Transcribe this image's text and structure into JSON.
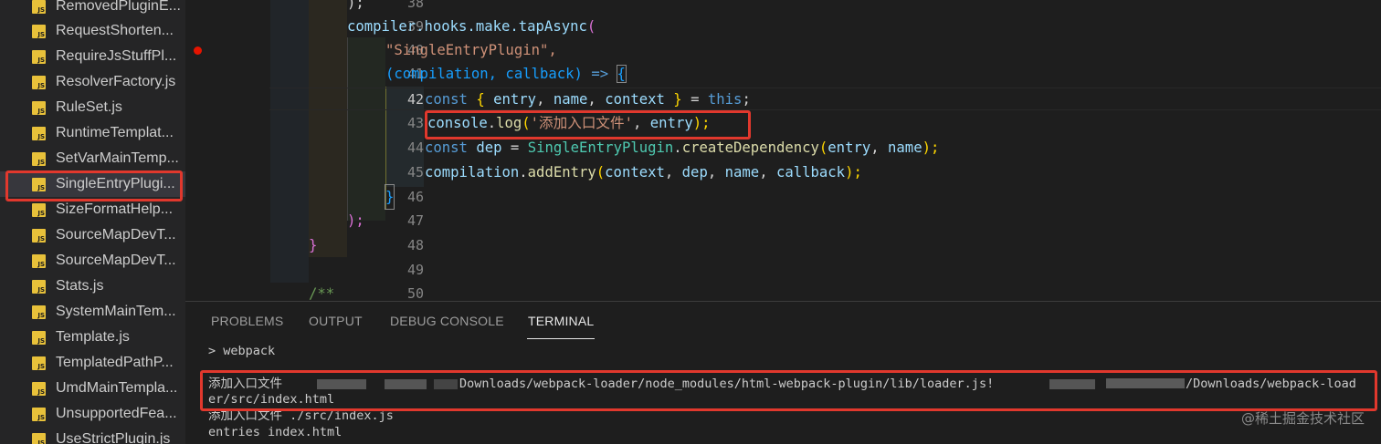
{
  "sidebar": {
    "files": [
      {
        "name": "RemovedPluginE..."
      },
      {
        "name": "RequestShorten..."
      },
      {
        "name": "RequireJsStuffPl..."
      },
      {
        "name": "ResolverFactory.js"
      },
      {
        "name": "RuleSet.js"
      },
      {
        "name": "RuntimeTemplat..."
      },
      {
        "name": "SetVarMainTemp..."
      },
      {
        "name": "SingleEntryPlugi..."
      },
      {
        "name": "SizeFormatHelp..."
      },
      {
        "name": "SourceMapDevT..."
      },
      {
        "name": "SourceMapDevT..."
      },
      {
        "name": "Stats.js"
      },
      {
        "name": "SystemMainTem..."
      },
      {
        "name": "Template.js"
      },
      {
        "name": "TemplatedPathP..."
      },
      {
        "name": "UmdMainTempla..."
      },
      {
        "name": "UnsupportedFea..."
      },
      {
        "name": "UseStrictPlugin.js"
      }
    ],
    "file_icon_text": "JS",
    "file_icon": "javascript-file-icon",
    "active_file_index": 7
  },
  "editor": {
    "line_numbers": [
      "38",
      "39",
      "40",
      "41",
      "42",
      "43",
      "44",
      "45",
      "46",
      "47",
      "48",
      "49",
      "50"
    ],
    "current_line": "42",
    "breakpoint_line": "40",
    "code": {
      "l38": ");",
      "l39_a": "compiler.hooks.make.tapAsync",
      "l39_b": "(",
      "l40": "\"SingleEntryPlugin\",",
      "l41_a": "(compilation, callback)",
      "l41_b": " => ",
      "l41_c": "{",
      "l42_a": "const",
      "l42_b": " { ",
      "l42_c": "entry",
      "l42_d": ", ",
      "l42_e": "name",
      "l42_f": ", ",
      "l42_g": "context",
      "l42_h": " } ",
      "l42_i": "= ",
      "l42_j": "this",
      "l42_k": ";",
      "l43_a": "console",
      "l43_b": ".",
      "l43_c": "log",
      "l43_d": "(",
      "l43_e": "'添加入口文件'",
      "l43_f": ", ",
      "l43_g": "entry",
      "l43_h": ");",
      "l44_a": "const",
      "l44_b": " dep ",
      "l44_c": "= ",
      "l44_d": "SingleEntryPlugin",
      "l44_e": ".",
      "l44_f": "createDependency",
      "l44_g": "(",
      "l44_h": "entry",
      "l44_i": ", ",
      "l44_j": "name",
      "l44_k": ");",
      "l45_a": "compilation",
      "l45_b": ".",
      "l45_c": "addEntry",
      "l45_d": "(",
      "l45_e": "context",
      "l45_f": ", ",
      "l45_g": "dep",
      "l45_h": ", ",
      "l45_i": "name",
      "l45_j": ", ",
      "l45_k": "callback",
      "l45_l": ");",
      "l46": "}",
      "l47": ");",
      "l48": "}",
      "l49": "",
      "l50": "/**"
    }
  },
  "panel": {
    "tabs": [
      {
        "label": "PROBLEMS"
      },
      {
        "label": "OUTPUT"
      },
      {
        "label": "DEBUG CONSOLE"
      },
      {
        "label": "TERMINAL"
      }
    ],
    "active_tab": "TERMINAL",
    "terminal": {
      "line1": "> webpack",
      "line2_prefix": "添加入口文件",
      "line2_a": "Downloads/webpack-loader/node_modules/html-webpack-plugin/lib/loader.js!",
      "line2_b": "/Downloads/webpack-load",
      "line3": "er/src/index.html",
      "line4": "添加入口文件 ./src/index.js",
      "line5": "entries index.html"
    }
  },
  "watermark": "@稀土掘金技术社区",
  "colors": {
    "highlight_box": "#e1382d",
    "breakpoint": "#e51400",
    "js_icon": "#e8c13a"
  }
}
